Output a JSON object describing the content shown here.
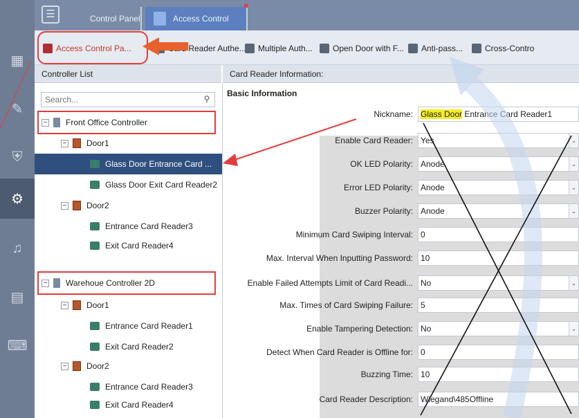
{
  "tabs": {
    "control_panel": "Control Panel",
    "access_control": "Access Control"
  },
  "toolbar": {
    "items": [
      "Access Control Pa...",
      "Card Reader Authe...",
      "Multiple Auth...",
      "Open Door with F...",
      "Anti-pass...",
      "Cross-Contro"
    ]
  },
  "left_panel": {
    "header": "Controller List",
    "search_placeholder": "Search...",
    "tree": [
      "Front Office Controller",
      "Door1",
      "Glass Door Entrance Card ...",
      "Glass Door Exit Card Reader2",
      "Door2",
      "Entrance Card Reader3",
      "Exit Card Reader4",
      "Warehoue Controller 2D",
      "Door1",
      "Entrance Card Reader1",
      "Exit Card Reader2",
      "Door2",
      "Entrance Card Reader3",
      "Exit Card Reader4"
    ]
  },
  "right_panel": {
    "header": "Card Reader Information:",
    "section_title": "Basic Information",
    "fields": [
      {
        "label": "Nickname:",
        "value_highlight": "Glass Door",
        "value_rest": " Entrance Card Reader1",
        "dropdown": false
      },
      {
        "label": "Enable Card Reader:",
        "value": "Yes",
        "dropdown": true
      },
      {
        "label": "OK LED Polarity:",
        "value": "Anode",
        "dropdown": true
      },
      {
        "label": "Error LED Polarity:",
        "value": "Anode",
        "dropdown": true
      },
      {
        "label": "Buzzer Polarity:",
        "value": "Anode",
        "dropdown": true
      },
      {
        "label": "Minimum Card Swiping Interval:",
        "value": "0",
        "dropdown": false
      },
      {
        "label": "Max. Interval When Inputting Password:",
        "value": "10",
        "dropdown": false
      },
      {
        "label": "Enable Failed Attempts Limit of Card Readi...",
        "value": "No",
        "dropdown": true
      },
      {
        "label": "Max. Times of Card Swiping Failure:",
        "value": "5",
        "dropdown": false
      },
      {
        "label": "Enable Tampering Detection:",
        "value": "No",
        "dropdown": true
      },
      {
        "label": "Detect When Card Reader is Offline for:",
        "value": "0",
        "dropdown": false
      },
      {
        "label": "Buzzing Time:",
        "value": "10",
        "dropdown": false
      },
      {
        "label": "Card Reader Description:",
        "value": "Wiegand\\485Offline",
        "dropdown": false
      }
    ]
  },
  "colors": {
    "sidebar": "#6e7d93",
    "tab_active": "#5b7fbf",
    "selected_row": "#2f4f7f",
    "annotation_red": "#e23c3c",
    "annotation_orange": "#e8602c",
    "highlight_yellow": "#f5ec2a"
  },
  "icons": [
    "grid-icon",
    "clipboard-icon",
    "shield-icon",
    "gear-icon",
    "microphone-icon",
    "report-icon",
    "keyboard-icon",
    "search-icon",
    "expand-icon",
    "controller-icon",
    "door-icon",
    "card-reader-icon",
    "dropdown-arrow-icon"
  ]
}
